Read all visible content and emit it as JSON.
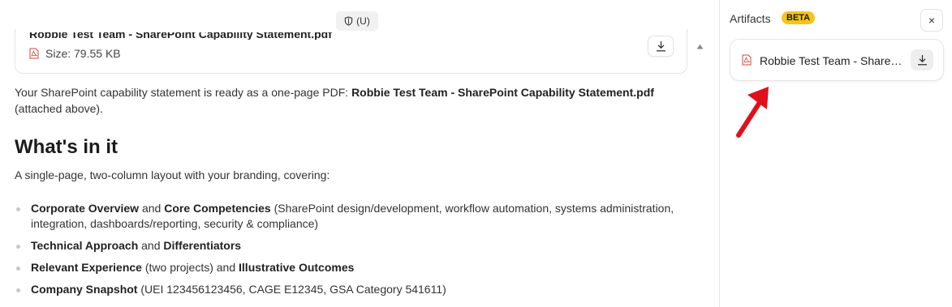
{
  "classification": {
    "label": "(U)",
    "icon": "shield-icon"
  },
  "file_card": {
    "name": "Robbie Test Team - SharePoint Capability Statement.pdf",
    "size": "Size: 79.55 KB",
    "icon": "pdf-icon",
    "download_icon": "download-icon"
  },
  "message": {
    "intro": "Your SharePoint capability statement is ready as a one-page PDF: ",
    "file_ref": "Robbie Test Team - SharePoint Capability Statement.pdf",
    "tail": "(attached above).",
    "heading": "What's in it",
    "summary": "A single-page, two-column layout with your branding, covering:",
    "points": [
      {
        "b1": "Corporate Overview",
        "mid": " and ",
        "b2": "Core Competencies",
        "rest": " (SharePoint design/development, workflow automation, systems administration, integration, dashboards/reporting, security & compliance)"
      },
      {
        "b1": "Technical Approach",
        "mid": " and ",
        "b2": "Differentiators",
        "rest": ""
      },
      {
        "b1": "Relevant Experience",
        "mid": " (two projects) and ",
        "b2": "Illustrative Outcomes",
        "rest": ""
      },
      {
        "b1": "Company Snapshot",
        "mid": " (UEI 123456123456, CAGE E12345, GSA Category 541611)",
        "b2": "",
        "rest": ""
      }
    ]
  },
  "artifacts": {
    "title": "Artifacts",
    "badge": "BETA",
    "close_label": "×",
    "items": [
      {
        "name": "Robbie Test Team - SharePoint Capability Statement.pdf",
        "icon": "pdf-icon",
        "download_icon": "download-icon"
      }
    ]
  },
  "colors": {
    "beta_badge": "#f5c518",
    "annotation_arrow": "#e0101c"
  }
}
